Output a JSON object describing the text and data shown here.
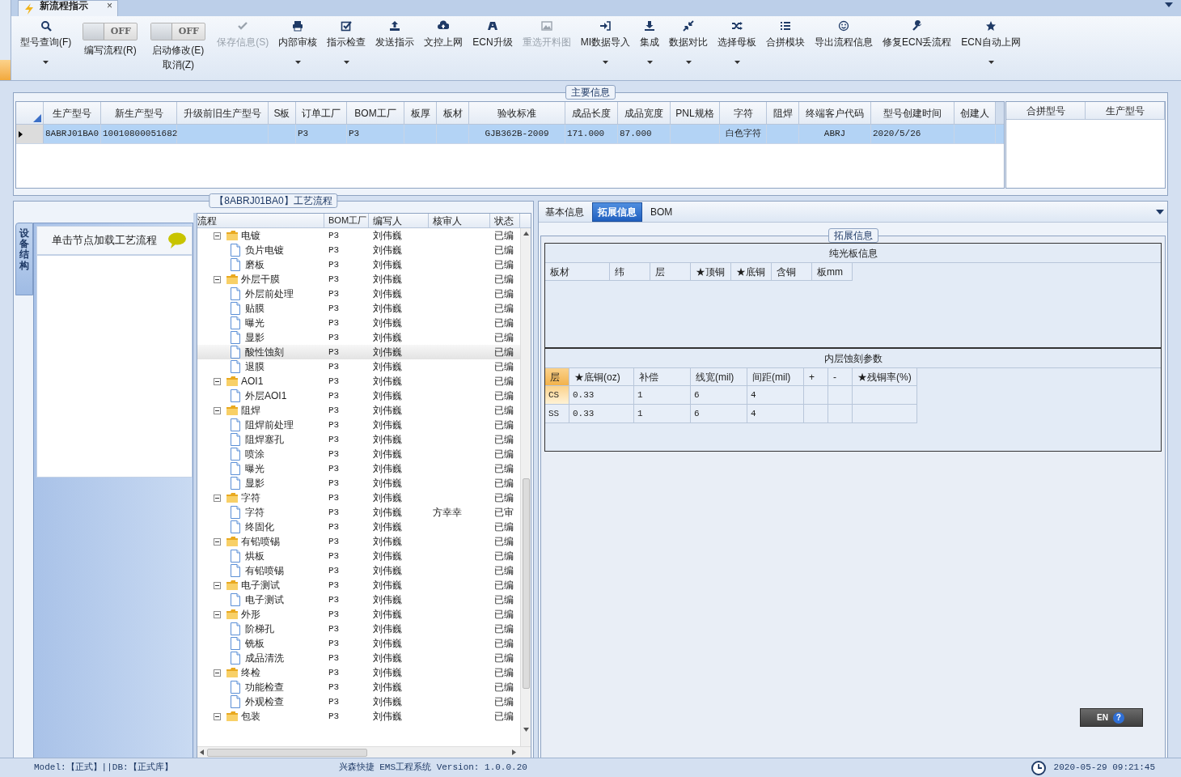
{
  "document_tab": {
    "title": "新流程指示",
    "close": "×",
    "selected": true
  },
  "toolbar": [
    {
      "kind": "button",
      "label": "型号查询(F)",
      "dropdown": true,
      "disabled": false
    },
    {
      "kind": "toggle",
      "label": "编写流程(R)",
      "switch": "OFF",
      "on": false
    },
    {
      "kind": "toggle",
      "label": "启动修改(E)",
      "label2": "取消(Z)",
      "switch": "OFF",
      "on": false
    },
    {
      "kind": "button",
      "label": "保存信息(S)",
      "dropdown": false,
      "disabled": true
    },
    {
      "kind": "button",
      "label": "内部审核",
      "dropdown": true,
      "disabled": false
    },
    {
      "kind": "button",
      "label": "指示检查",
      "dropdown": true,
      "disabled": false
    },
    {
      "kind": "button",
      "label": "发送指示",
      "dropdown": false,
      "disabled": false
    },
    {
      "kind": "button",
      "label": "文控上网",
      "dropdown": false,
      "disabled": false
    },
    {
      "kind": "button",
      "label": "ECN升级",
      "dropdown": false,
      "disabled": false
    },
    {
      "kind": "button",
      "label": "重选开料图",
      "dropdown": false,
      "disabled": true
    },
    {
      "kind": "button",
      "label": "MI数据导入",
      "dropdown": true,
      "disabled": false
    },
    {
      "kind": "button",
      "label": "集成",
      "dropdown": true,
      "disabled": false
    },
    {
      "kind": "button",
      "label": "数据对比",
      "dropdown": true,
      "disabled": false
    },
    {
      "kind": "button",
      "label": "选择母板",
      "dropdown": true,
      "disabled": false
    },
    {
      "kind": "button",
      "label": "合拼模块",
      "dropdown": false,
      "disabled": false
    },
    {
      "kind": "button",
      "label": "导出流程信息",
      "dropdown": false,
      "disabled": false
    },
    {
      "kind": "button",
      "label": "修复ECN丢流程",
      "dropdown": false,
      "disabled": false
    },
    {
      "kind": "button",
      "label": "ECN自动上网",
      "dropdown": true,
      "disabled": false
    }
  ],
  "main_info": {
    "legend": "主要信息",
    "columns": [
      "生产型号",
      "新生产型号",
      "升级前旧生产型号",
      "S板",
      "订单工厂",
      "BOM工厂",
      "板厚",
      "板材",
      "验收标准",
      "成品长度",
      "成品宽度",
      "PNL规格",
      "字符",
      "阻焊",
      "终端客户代码",
      "型号创建时间",
      "创建人"
    ],
    "rows": [
      {
        "selected": true,
        "cells": [
          "8ABRJ01BA0",
          "10010800051682",
          null,
          null,
          "P3",
          "P3",
          null,
          null,
          "GJB362B-2009",
          "171.000",
          "87.000",
          null,
          "白色字符",
          null,
          "ABRJ",
          "2020/5/26",
          null
        ]
      }
    ],
    "merge_columns": [
      "合拼型号",
      "生产型号"
    ]
  },
  "process": {
    "legend": "【8ABRJ01BA0】工艺流程",
    "side_tab": "设备结构",
    "side_item": "单击节点加载工艺流程",
    "columns": [
      "流程",
      "BOM工厂",
      "编写人",
      "核审人",
      "状态"
    ],
    "tree": [
      {
        "label": "电镀",
        "bom": "P3",
        "writer": "刘伟巍",
        "status": "已编",
        "selected": false,
        "expanded": true,
        "children": [
          {
            "label": "负片电镀",
            "bom": "P3",
            "writer": "刘伟巍",
            "status": "已编",
            "selected": false
          },
          {
            "label": "磨板",
            "bom": "P3",
            "writer": "刘伟巍",
            "status": "已编",
            "selected": false
          }
        ]
      },
      {
        "label": "外层干膜",
        "bom": "P3",
        "writer": "刘伟巍",
        "status": "已编",
        "selected": false,
        "expanded": true,
        "children": [
          {
            "label": "外层前处理",
            "bom": "P3",
            "writer": "刘伟巍",
            "status": "已编",
            "selected": false
          },
          {
            "label": "贴膜",
            "bom": "P3",
            "writer": "刘伟巍",
            "status": "已编",
            "selected": false
          },
          {
            "label": "曝光",
            "bom": "P3",
            "writer": "刘伟巍",
            "status": "已编",
            "selected": false
          },
          {
            "label": "显影",
            "bom": "P3",
            "writer": "刘伟巍",
            "status": "已编",
            "selected": false
          },
          {
            "label": "酸性蚀刻",
            "bom": "P3",
            "writer": "刘伟巍",
            "status": "已编",
            "selected": true
          },
          {
            "label": "退膜",
            "bom": "P3",
            "writer": "刘伟巍",
            "status": "已编",
            "selected": false
          }
        ]
      },
      {
        "label": "AOI1",
        "bom": "P3",
        "writer": "刘伟巍",
        "status": "已编",
        "selected": false,
        "expanded": true,
        "children": [
          {
            "label": "外层AOI1",
            "bom": "P3",
            "writer": "刘伟巍",
            "status": "已编",
            "selected": false
          }
        ]
      },
      {
        "label": "阻焊",
        "bom": "P3",
        "writer": "刘伟巍",
        "status": "已编",
        "selected": false,
        "expanded": true,
        "children": [
          {
            "label": "阻焊前处理",
            "bom": "P3",
            "writer": "刘伟巍",
            "status": "已编",
            "selected": false
          },
          {
            "label": "阻焊塞孔",
            "bom": "P3",
            "writer": "刘伟巍",
            "status": "已编",
            "selected": false
          },
          {
            "label": "喷涂",
            "bom": "P3",
            "writer": "刘伟巍",
            "status": "已编",
            "selected": false
          },
          {
            "label": "曝光",
            "bom": "P3",
            "writer": "刘伟巍",
            "status": "已编",
            "selected": false
          },
          {
            "label": "显影",
            "bom": "P3",
            "writer": "刘伟巍",
            "status": "已编",
            "selected": false
          }
        ]
      },
      {
        "label": "字符",
        "bom": "P3",
        "writer": "刘伟巍",
        "status": "已编",
        "selected": false,
        "expanded": true,
        "children": [
          {
            "label": "字符",
            "bom": "P3",
            "writer": "刘伟巍",
            "reviewer": "方幸幸",
            "status": "已审",
            "selected": false
          },
          {
            "label": "终固化",
            "bom": "P3",
            "writer": "刘伟巍",
            "status": "已编",
            "selected": false
          }
        ]
      },
      {
        "label": "有铅喷锡",
        "bom": "P3",
        "writer": "刘伟巍",
        "status": "已编",
        "selected": false,
        "expanded": true,
        "children": [
          {
            "label": "烘板",
            "bom": "P3",
            "writer": "刘伟巍",
            "status": "已编",
            "selected": false
          },
          {
            "label": "有铅喷锡",
            "bom": "P3",
            "writer": "刘伟巍",
            "status": "已编",
            "selected": false
          }
        ]
      },
      {
        "label": "电子测试",
        "bom": "P3",
        "writer": "刘伟巍",
        "status": "已编",
        "selected": false,
        "expanded": true,
        "children": [
          {
            "label": "电子测试",
            "bom": "P3",
            "writer": "刘伟巍",
            "status": "已编",
            "selected": false
          }
        ]
      },
      {
        "label": "外形",
        "bom": "P3",
        "writer": "刘伟巍",
        "status": "已编",
        "selected": false,
        "expanded": true,
        "children": [
          {
            "label": "阶梯孔",
            "bom": "P3",
            "writer": "刘伟巍",
            "status": "已编",
            "selected": false
          },
          {
            "label": "铣板",
            "bom": "P3",
            "writer": "刘伟巍",
            "status": "已编",
            "selected": false
          },
          {
            "label": "成品清洗",
            "bom": "P3",
            "writer": "刘伟巍",
            "status": "已编",
            "selected": false
          }
        ]
      },
      {
        "label": "终检",
        "bom": "P3",
        "writer": "刘伟巍",
        "status": "已编",
        "selected": false,
        "expanded": true,
        "children": [
          {
            "label": "功能检查",
            "bom": "P3",
            "writer": "刘伟巍",
            "status": "已编",
            "selected": false
          },
          {
            "label": "外观检查",
            "bom": "P3",
            "writer": "刘伟巍",
            "status": "已编",
            "selected": false
          }
        ]
      },
      {
        "label": "包装",
        "bom": "P3",
        "writer": "刘伟巍",
        "status": "已编",
        "selected": false,
        "expanded": true
      }
    ]
  },
  "detail": {
    "tabs": [
      {
        "label": "基本信息",
        "selected": false
      },
      {
        "label": "拓展信息",
        "selected": true
      },
      {
        "label": "BOM",
        "selected": false
      }
    ],
    "legend": "拓展信息",
    "board": {
      "title": "纯光板信息",
      "columns": [
        "板材",
        "纬",
        "层",
        "★顶铜",
        "★底铜",
        "含铜",
        "板mm"
      ]
    },
    "etch": {
      "title": "内层蚀刻参数",
      "columns": [
        "层",
        "★底铜(oz)",
        "补偿",
        "线宽(mil)",
        "间距(mil)",
        "+",
        "-",
        "★残铜率(%)"
      ],
      "rows": [
        {
          "selected": true,
          "cells": [
            "CS",
            "0.33",
            "1",
            "6",
            "4",
            null,
            null,
            null
          ]
        },
        {
          "selected": false,
          "cells": [
            "SS",
            "0.33",
            "1",
            "6",
            "4",
            null,
            null,
            null
          ]
        }
      ]
    }
  },
  "ime": {
    "label": "EN",
    "help": "?"
  },
  "status_bar": {
    "left": "Model:【正式】||DB:【正式库】",
    "center": "兴森快捷 EMS工程系统 Version: 1.0.0.20",
    "time": "2020-05-29 09:21:45"
  }
}
